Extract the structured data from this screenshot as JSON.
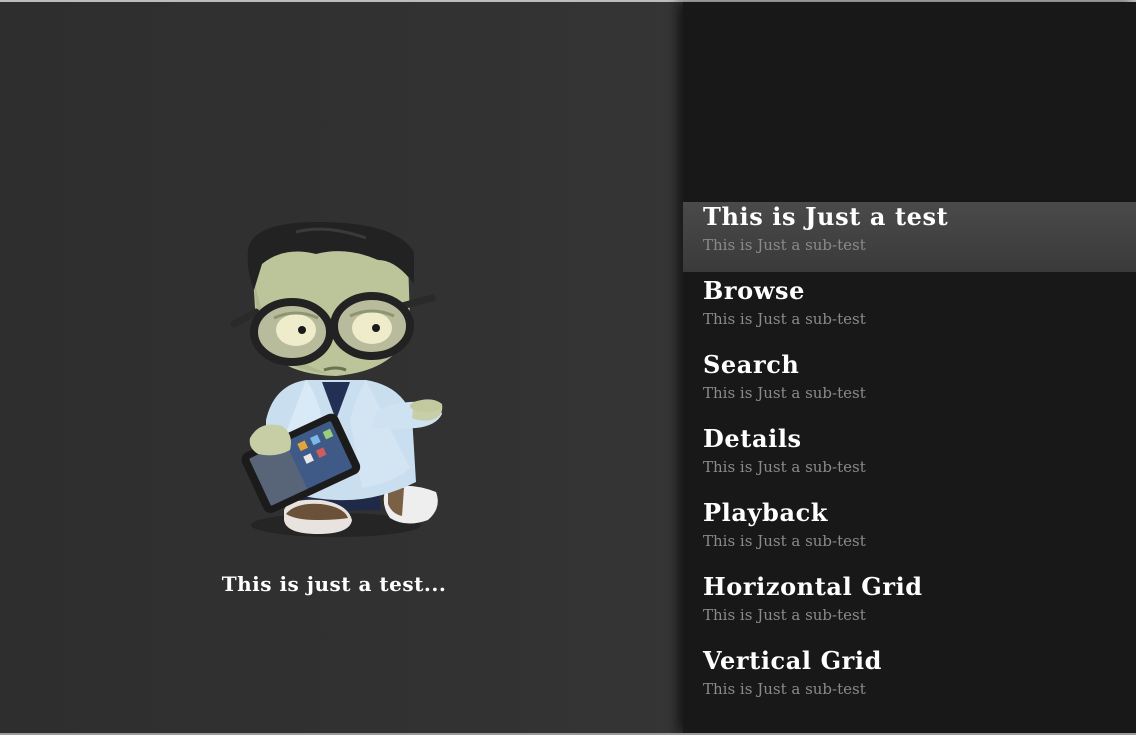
{
  "left_panel": {
    "caption": "This is just a test...",
    "mascot_icon": "zombie-with-tablet-icon"
  },
  "menu": {
    "items": [
      {
        "title": "This is Just a test",
        "subtitle": "This is Just a sub-test",
        "selected": true
      },
      {
        "title": "Browse",
        "subtitle": "This is Just a sub-test",
        "selected": false
      },
      {
        "title": "Search",
        "subtitle": "This is Just a sub-test",
        "selected": false
      },
      {
        "title": "Details",
        "subtitle": "This is Just a sub-test",
        "selected": false
      },
      {
        "title": "Playback",
        "subtitle": "This is Just a sub-test",
        "selected": false
      },
      {
        "title": "Horizontal Grid",
        "subtitle": "This is Just a sub-test",
        "selected": false
      },
      {
        "title": "Vertical Grid",
        "subtitle": "This is Just a sub-test",
        "selected": false
      }
    ]
  },
  "colors": {
    "left_background": "#2f2f2f",
    "right_background": "#181818",
    "selected_highlight": "#444444",
    "title_text": "#ffffff",
    "subtitle_text": "#8a8a8a"
  }
}
